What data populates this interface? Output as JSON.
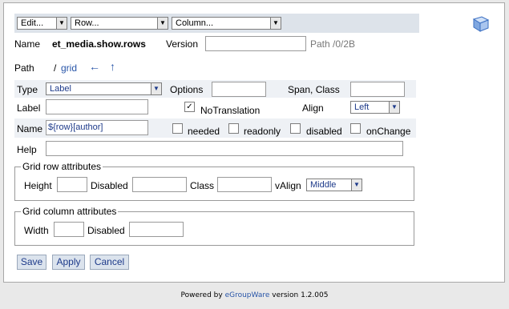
{
  "toolbar": {
    "edit": "Edit...",
    "row": "Row...",
    "column": "Column..."
  },
  "header": {
    "name_label": "Name",
    "name_value": "et_media.show.rows",
    "version_label": "Version",
    "version_value": "",
    "path_info": "Path /0/2B",
    "path_label": "Path",
    "path_prefix": "/",
    "path_link": "grid",
    "left_arrow": "←",
    "up_arrow": "↑"
  },
  "form": {
    "type_label": "Type",
    "type_value": "Label",
    "options_label": "Options",
    "options_value": "",
    "span_class_label": "Span, Class",
    "span_class_value": "",
    "label_label": "Label",
    "label_value": "",
    "notranslation_label": "NoTranslation",
    "notranslation_checked": "✓",
    "align_label": "Align",
    "align_value": "Left",
    "name_label": "Name",
    "name_value": "${row}[author]",
    "needed_label": "needed",
    "readonly_label": "readonly",
    "disabled_label": "disabled",
    "onchange_label": "onChange",
    "help_label": "Help",
    "help_value": ""
  },
  "grid_row": {
    "legend": "Grid row attributes",
    "height_label": "Height",
    "height_value": "",
    "disabled_label": "Disabled",
    "disabled_value": "",
    "class_label": "Class",
    "class_value": "",
    "valign_label": "vAlign",
    "valign_value": "Middle"
  },
  "grid_column": {
    "legend": "Grid column attributes",
    "width_label": "Width",
    "width_value": "",
    "disabled_label": "Disabled",
    "disabled_value": ""
  },
  "buttons": {
    "save": "Save",
    "apply": "Apply",
    "cancel": "Cancel"
  },
  "footer": {
    "prefix": "Powered by ",
    "link": "eGroupWare",
    "suffix": " version 1.2.005"
  },
  "icons": {
    "help": "book-icon"
  },
  "colors": {
    "toolbar_bg": "#dde3ea",
    "link": "#2855a8",
    "button_bg": "#dbe3ed"
  }
}
